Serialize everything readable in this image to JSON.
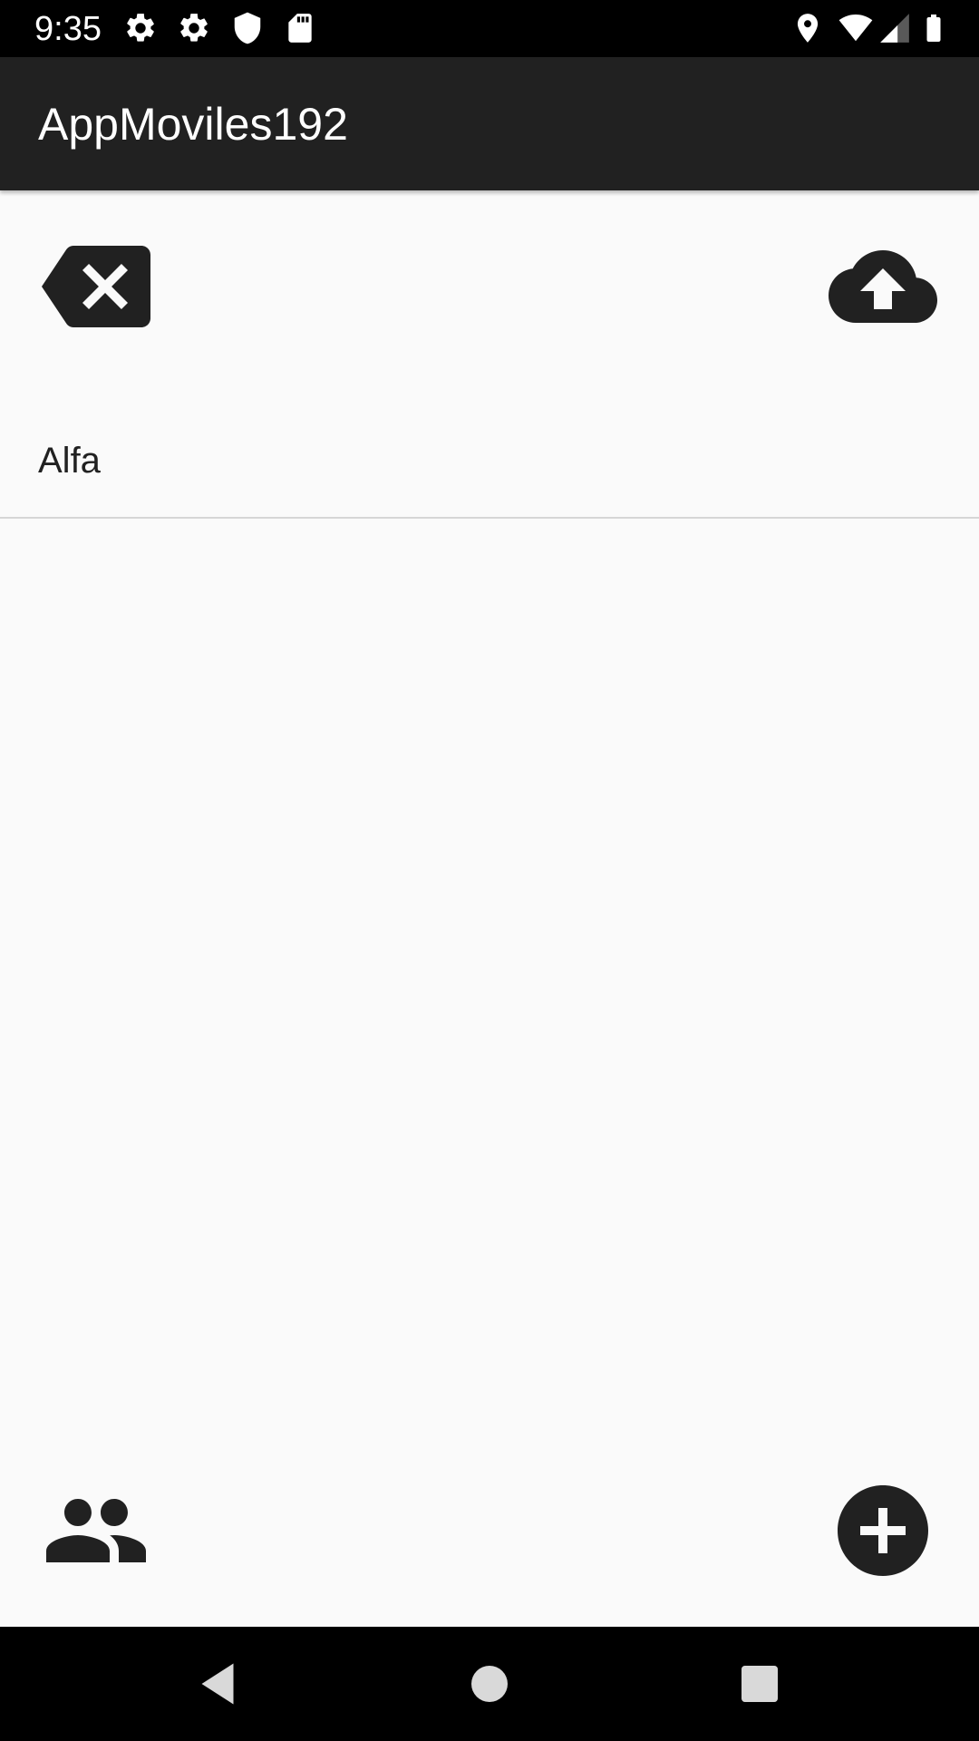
{
  "status_bar": {
    "time": "9:35",
    "left_icons": [
      "gear-icon",
      "gear-icon",
      "shield-icon",
      "sd-card-icon"
    ],
    "right_icons": [
      "location-icon",
      "wifi-icon",
      "signal-icon",
      "battery-icon"
    ]
  },
  "app_bar": {
    "title": "AppMoviles192",
    "background": "#212121"
  },
  "toolbar": {
    "left_icon": "backspace-icon",
    "right_icon": "cloud-upload-icon"
  },
  "list": {
    "items": [
      {
        "label": "Alfa"
      }
    ]
  },
  "bottom_actions": {
    "left_icon": "people-icon",
    "right_icon": "add-circle-icon"
  },
  "nav_bar": {
    "icons": [
      "back-triangle-icon",
      "home-circle-icon",
      "recents-square-icon"
    ]
  },
  "colors": {
    "background": "#fafafa",
    "icon": "#212121",
    "divider": "#d6d6d6"
  }
}
